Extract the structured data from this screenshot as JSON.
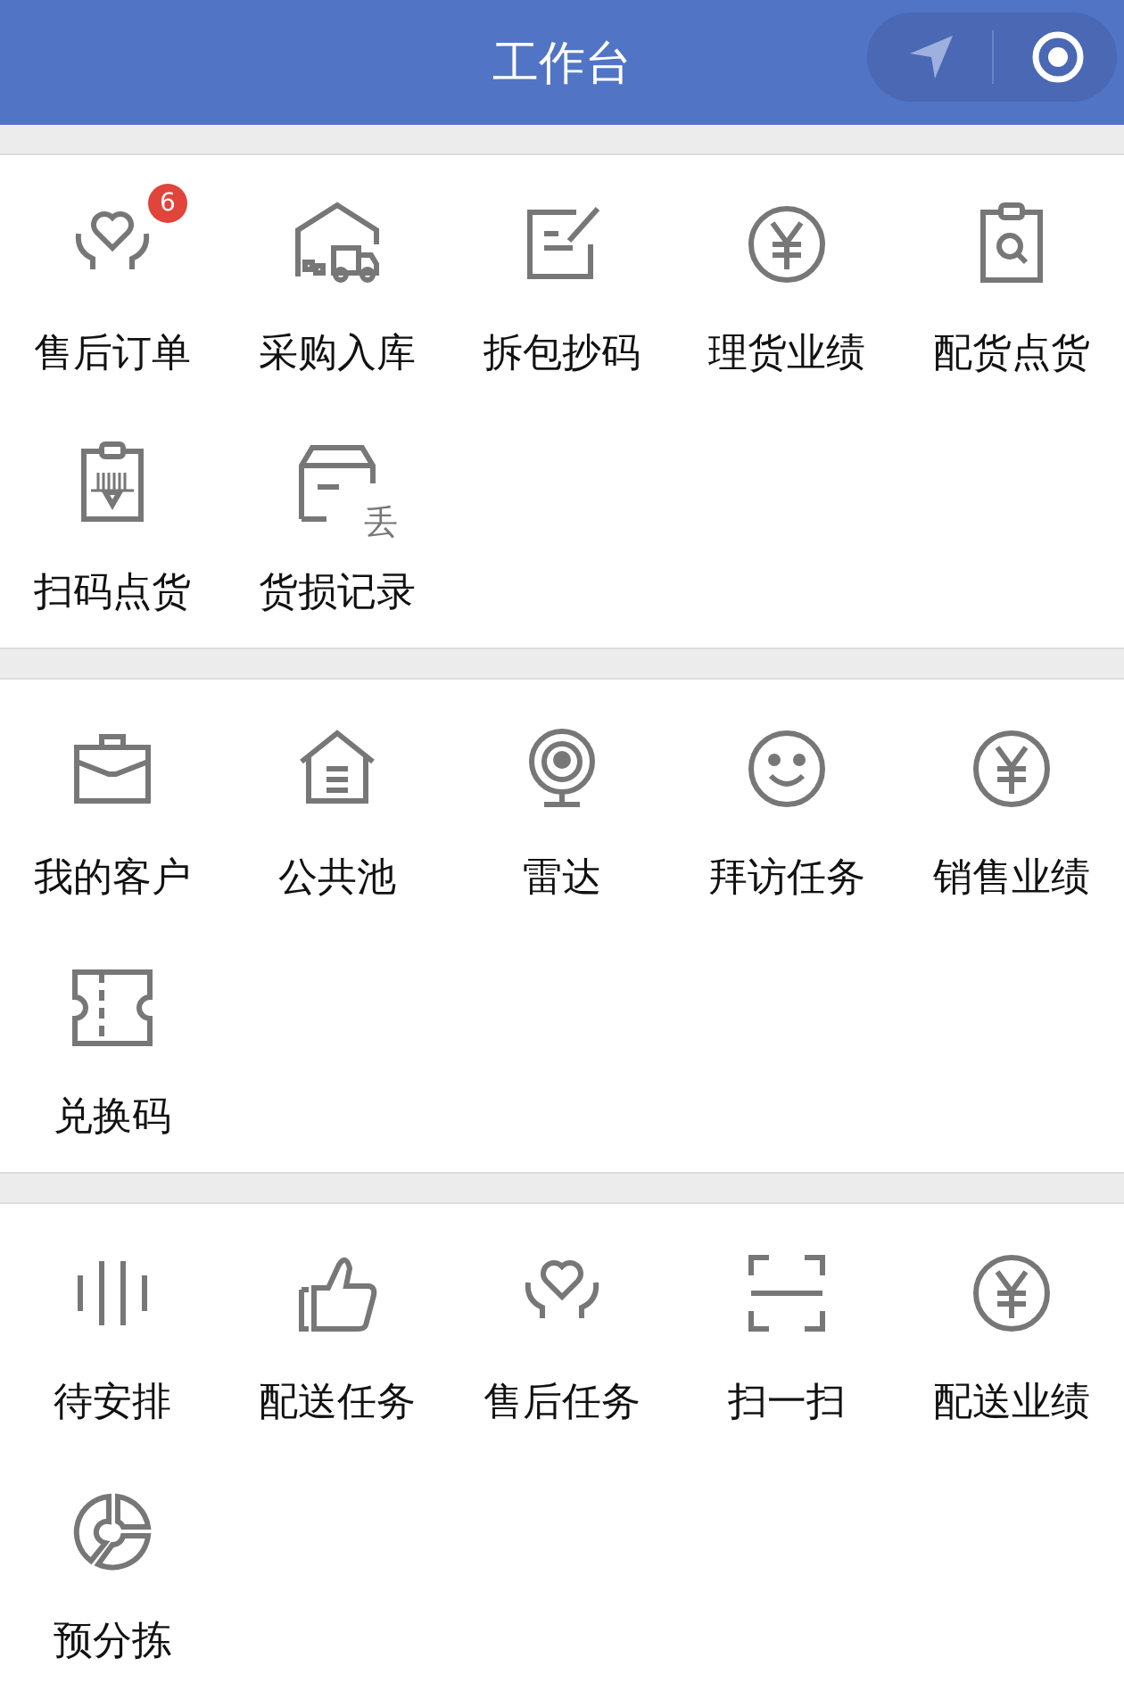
{
  "header": {
    "title": "工作台"
  },
  "sections": [
    {
      "items": [
        {
          "label": "售后订单",
          "kind": "heart",
          "badge": "6"
        },
        {
          "label": "采购入库",
          "kind": "truck"
        },
        {
          "label": "拆包抄码",
          "kind": "note"
        },
        {
          "label": "理货业绩",
          "kind": "yen"
        },
        {
          "label": "配货点货",
          "kind": "clipboard"
        },
        {
          "label": "扫码点货",
          "kind": "barcode"
        },
        {
          "label": "货损记录",
          "kind": "box",
          "icon_mark": "丢"
        }
      ]
    },
    {
      "items": [
        {
          "label": "我的客户",
          "kind": "briefcase"
        },
        {
          "label": "公共池",
          "kind": "house"
        },
        {
          "label": "雷达",
          "kind": "webcam"
        },
        {
          "label": "拜访任务",
          "kind": "smiley"
        },
        {
          "label": "销售业绩",
          "kind": "yen"
        },
        {
          "label": "兑换码",
          "kind": "ticket"
        }
      ]
    },
    {
      "items": [
        {
          "label": "待安排",
          "kind": "bars"
        },
        {
          "label": "配送任务",
          "kind": "thumb"
        },
        {
          "label": "售后任务",
          "kind": "heart"
        },
        {
          "label": "扫一扫",
          "kind": "scan"
        },
        {
          "label": "配送业绩",
          "kind": "yen"
        },
        {
          "label": "预分拣",
          "kind": "pie"
        }
      ]
    }
  ]
}
